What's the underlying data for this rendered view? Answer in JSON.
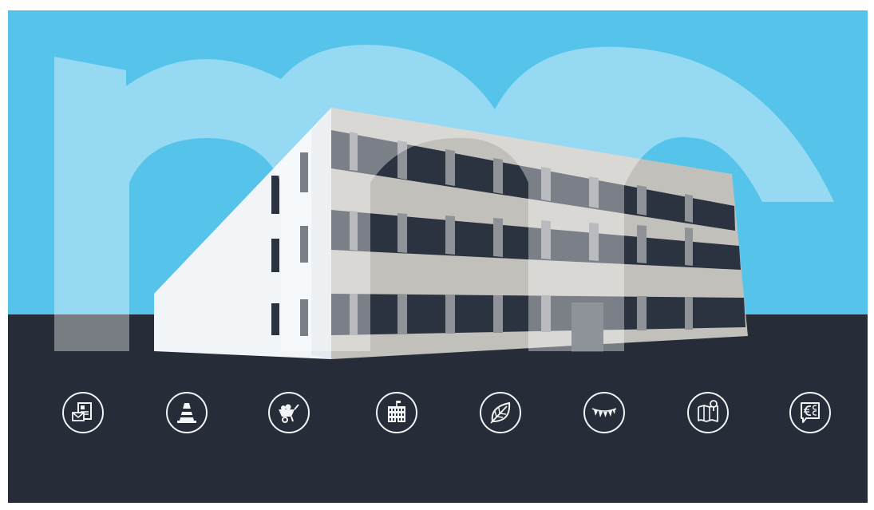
{
  "colors": {
    "sky": "#55c3ea",
    "ground": "#262d38",
    "logo_overlay": "#ffffff",
    "building_front": "#c2c0bb",
    "building_side": "#f1f5f8",
    "window_dark": "#2b3340",
    "icon_stroke": "#f2f4f6"
  },
  "logo": {
    "shape": "lowercase letters m and n (partially hidden) drawn as translucent overlay"
  },
  "icons": [
    {
      "name": "contact-card-icon"
    },
    {
      "name": "traffic-cone-icon"
    },
    {
      "name": "wheelbarrow-icon"
    },
    {
      "name": "building-icon"
    },
    {
      "name": "leaf-icon"
    },
    {
      "name": "bunting-icon"
    },
    {
      "name": "map-pin-icon"
    },
    {
      "name": "euro-sign-icon"
    }
  ]
}
